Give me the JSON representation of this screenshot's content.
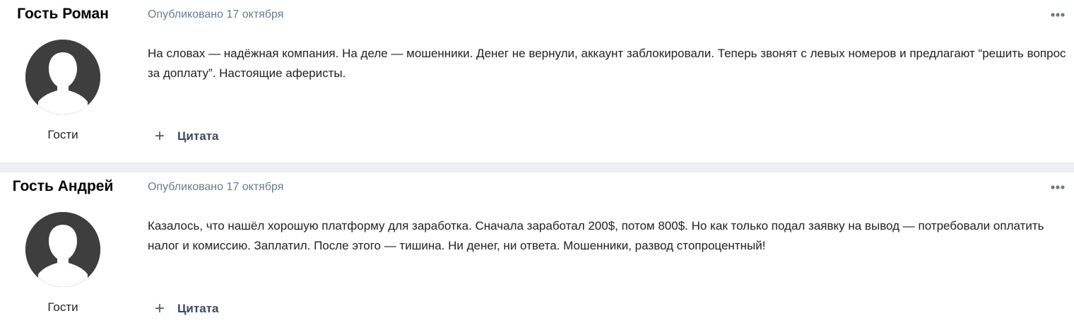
{
  "posts": [
    {
      "author": "Гость Роман",
      "group": "Гости",
      "date_label": "Опубликовано",
      "date": "17 октября",
      "text": "На словах — надёжная компания. На деле — мошенники. Денег не вернули, аккаунт заблокировали. Теперь звонят с левых номеров и предлагают “решить вопрос за доплату”. Настоящие аферисты.",
      "quote_icon": "+",
      "quote_label": "Цитата",
      "more_icon": "ellipsis-icon"
    },
    {
      "author": "Гость Андрей",
      "group": "Гости",
      "date_label": "Опубликовано",
      "date": "17 октября",
      "text": "Казалось, что нашёл хорошую платформу для заработка. Сначала заработал 200$, потом 800$. Но как только подал заявку на вывод — потребовали оплатить налог и комиссию. Заплатил. После этого — тишина. Ни денег, ни ответа. Мошенники, развод стопроцентный!",
      "quote_icon": "+",
      "quote_label": "Цитата",
      "more_icon": "ellipsis-icon"
    }
  ],
  "colors": {
    "meta_text": "#6b7b8e",
    "body_text": "#222222",
    "avatar_bg": "#3e3e3e",
    "separator": "#eef0f3"
  }
}
